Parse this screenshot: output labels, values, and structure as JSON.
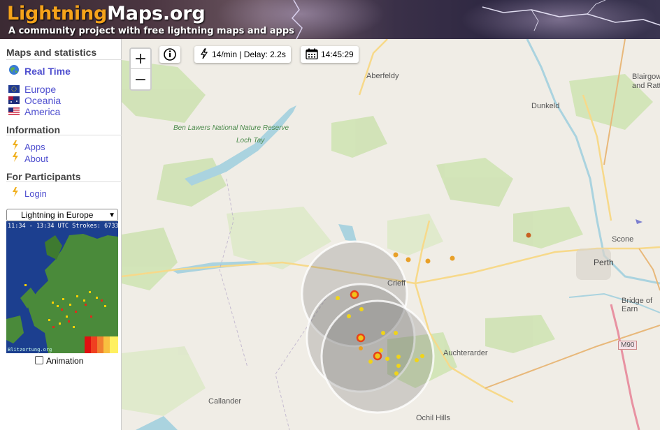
{
  "header": {
    "logo_part1": "Lightning",
    "logo_part2": "Maps.org",
    "tagline": "A community project with free lightning maps and apps"
  },
  "sidebar": {
    "maps_title": "Maps and statistics",
    "realtime_label": "Real Time",
    "regions": [
      {
        "label": "Europe",
        "icon": "eu-flag-icon"
      },
      {
        "label": "Oceania",
        "icon": "australia-flag-icon"
      },
      {
        "label": "America",
        "icon": "us-flag-icon"
      }
    ],
    "info_title": "Information",
    "info_links": [
      "Apps",
      "About"
    ],
    "participants_title": "For Participants",
    "login_label": "Login",
    "region_select_value": "Lightning in Europe",
    "minimap_caption": "11:34 - 13:34 UTC Strokes: 6733",
    "minimap_watermark": "Blitzortung.org",
    "animation_label": "Animation"
  },
  "map": {
    "zoom_in": "+",
    "zoom_out": "−",
    "info_icon": "info-icon",
    "rate_text": "14/min | Delay: 2.2s",
    "time_text": "14:45:29",
    "places": {
      "aberfeldy": "Aberfeldy",
      "blairgowrie": "Blairgow",
      "rattray": "and Ratt",
      "dunkeld": "Dunkeld",
      "ben_lawers": "Ben Lawers National Nature Reserve",
      "loch_tay": "Loch Tay",
      "scone": "Scone",
      "perth": "Perth",
      "crieff": "Crieff",
      "bridge_of_earn": "Bridge of Earn",
      "auchterarder": "Auchterarder",
      "callander": "Callander",
      "ochil_hills": "Ochil Hills",
      "m90": "M90"
    },
    "colors": {
      "strike_recent": "#e8421a",
      "strike_old": "#f0c419",
      "strike_older": "#e8a028",
      "water": "#aad3df",
      "forest": "#c8dfae"
    }
  }
}
